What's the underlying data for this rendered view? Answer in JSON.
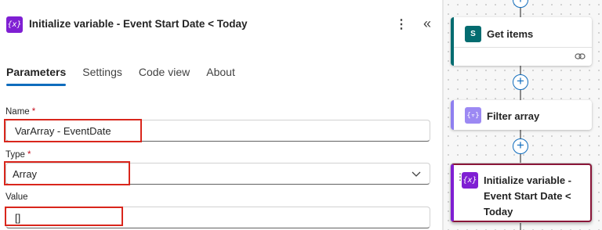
{
  "panel": {
    "title": "Initialize variable - Event Start Date < Today",
    "icon": "variable-icon",
    "accent": "#7f1fd3",
    "more_label": "⋮",
    "collapse_label": "«"
  },
  "tabs": [
    {
      "label": "Parameters",
      "active": true
    },
    {
      "label": "Settings",
      "active": false
    },
    {
      "label": "Code view",
      "active": false
    },
    {
      "label": "About",
      "active": false
    }
  ],
  "fields": {
    "name": {
      "label": "Name",
      "required_mark": "*",
      "value": "VarArray - EventDate"
    },
    "type": {
      "label": "Type",
      "required_mark": "*",
      "value": "Array"
    },
    "value": {
      "label": "Value",
      "value": "[]"
    }
  },
  "flow": {
    "cards": [
      {
        "title": "Get items",
        "icon": "sharepoint-icon",
        "icon_text": "S",
        "color": "#036c70"
      },
      {
        "title": "Filter array",
        "icon": "filter-array-icon",
        "color": "#9c89f3"
      },
      {
        "title": "Initialize variable - Event Start Date < Today",
        "icon": "variable-icon",
        "color": "#7f1fd3",
        "selected": true
      }
    ],
    "add_step_label": "+"
  },
  "colors": {
    "highlight_box": "#d9261c",
    "tab_underline": "#0f6cbd",
    "required": "#c50f1f"
  }
}
